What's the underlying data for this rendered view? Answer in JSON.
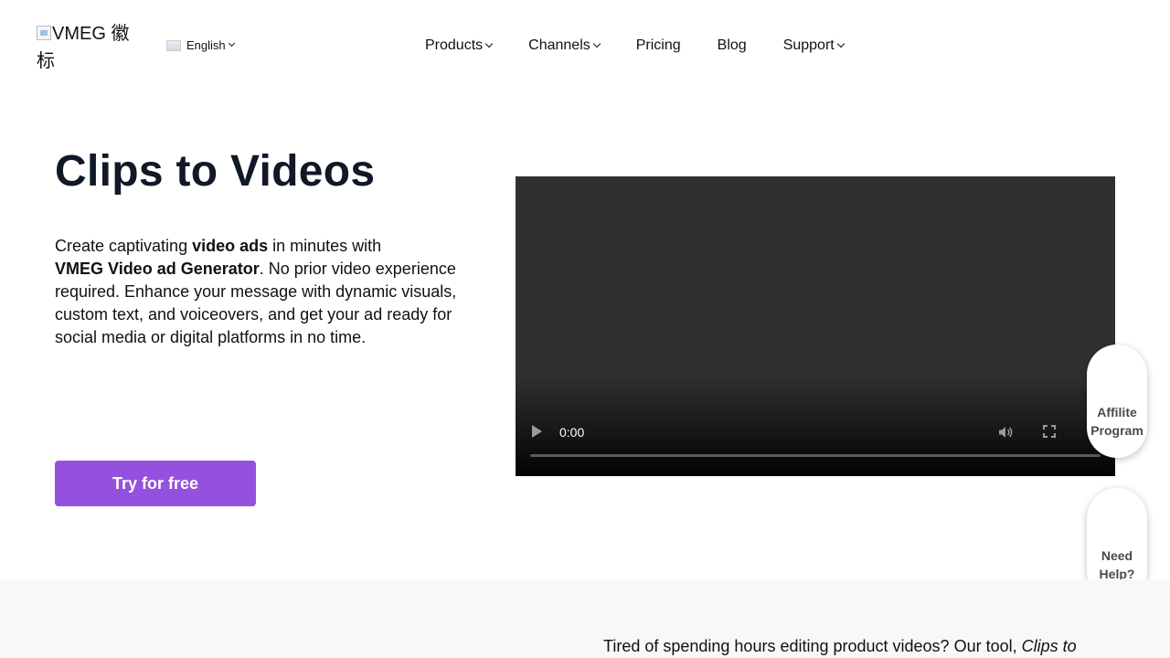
{
  "header": {
    "logo_alt": "VMEG 徽标",
    "language": "English",
    "nav": [
      {
        "label": "Products",
        "dropdown": true
      },
      {
        "label": "Channels",
        "dropdown": true
      },
      {
        "label": "Pricing",
        "dropdown": false
      },
      {
        "label": "Blog",
        "dropdown": false
      },
      {
        "label": "Support",
        "dropdown": true
      }
    ]
  },
  "hero": {
    "title": "Clips to Videos",
    "desc": {
      "p1": "Create captivating ",
      "b1": "video ads",
      "p2": " in minutes with ",
      "b2": "VMEG Video ad Generator",
      "p3": ". No prior video experience required. Enhance your message with dynamic visuals, custom text, and voiceovers, and get your ad ready for social media or digital platforms in no time."
    },
    "cta_label": "Try for free"
  },
  "video": {
    "current_time": "0:00",
    "progress": 0
  },
  "floating": {
    "affiliate_line1": "Affilite",
    "affiliate_line2": "Program",
    "help_line1": "Need",
    "help_line2": "Help?"
  },
  "lower": {
    "text_before": "Tired of spending hours editing product videos? Our tool, ",
    "text_italic": "Clips to"
  },
  "colors": {
    "accent": "#9451dd",
    "video_bg": "#303030",
    "section_bg": "#f7f8fa"
  }
}
